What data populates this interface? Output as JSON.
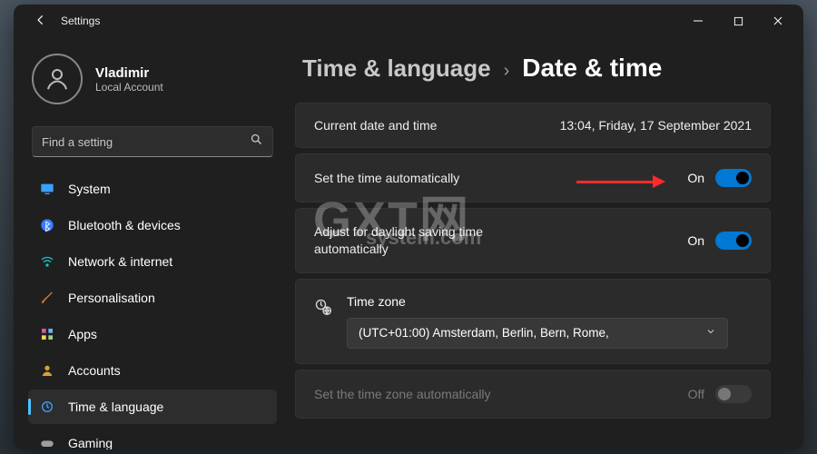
{
  "window": {
    "title": "Settings"
  },
  "user": {
    "name": "Vladimir",
    "account_type": "Local Account"
  },
  "search": {
    "placeholder": "Find a setting"
  },
  "sidebar": {
    "items": [
      {
        "icon": "monitor",
        "label": "System",
        "color": "#3aa0ff"
      },
      {
        "icon": "bluetooth",
        "label": "Bluetooth & devices",
        "color": "#3a7bff"
      },
      {
        "icon": "wifi",
        "label": "Network & internet",
        "color": "#17c7c7"
      },
      {
        "icon": "brush",
        "label": "Personalisation",
        "color": "#c27b3d"
      },
      {
        "icon": "apps",
        "label": "Apps",
        "color": "#d85b9c"
      },
      {
        "icon": "person",
        "label": "Accounts",
        "color": "#d7a03a"
      },
      {
        "icon": "clock",
        "label": "Time & language",
        "color": "#3aa0ff",
        "active": true
      },
      {
        "icon": "gamepad",
        "label": "Gaming",
        "color": "#9e9e9e"
      }
    ]
  },
  "breadcrumb": {
    "parent": "Time & language",
    "current": "Date & time"
  },
  "settings": {
    "current_time": {
      "label": "Current date and time",
      "value": "13:04, Friday, 17 September 2021"
    },
    "auto_time": {
      "label": "Set the time automatically",
      "state": "On",
      "on": true
    },
    "dst": {
      "label_line1": "Adjust for daylight saving time",
      "label_line2": "automatically",
      "state": "On",
      "on": true
    },
    "timezone": {
      "title": "Time zone",
      "selected": "(UTC+01:00) Amsterdam, Berlin, Bern, Rome,"
    },
    "auto_tz": {
      "label": "Set the time zone automatically",
      "state": "Off",
      "on": false,
      "disabled": true
    }
  },
  "watermark": {
    "big": "GXT网",
    "small": "system.com"
  }
}
